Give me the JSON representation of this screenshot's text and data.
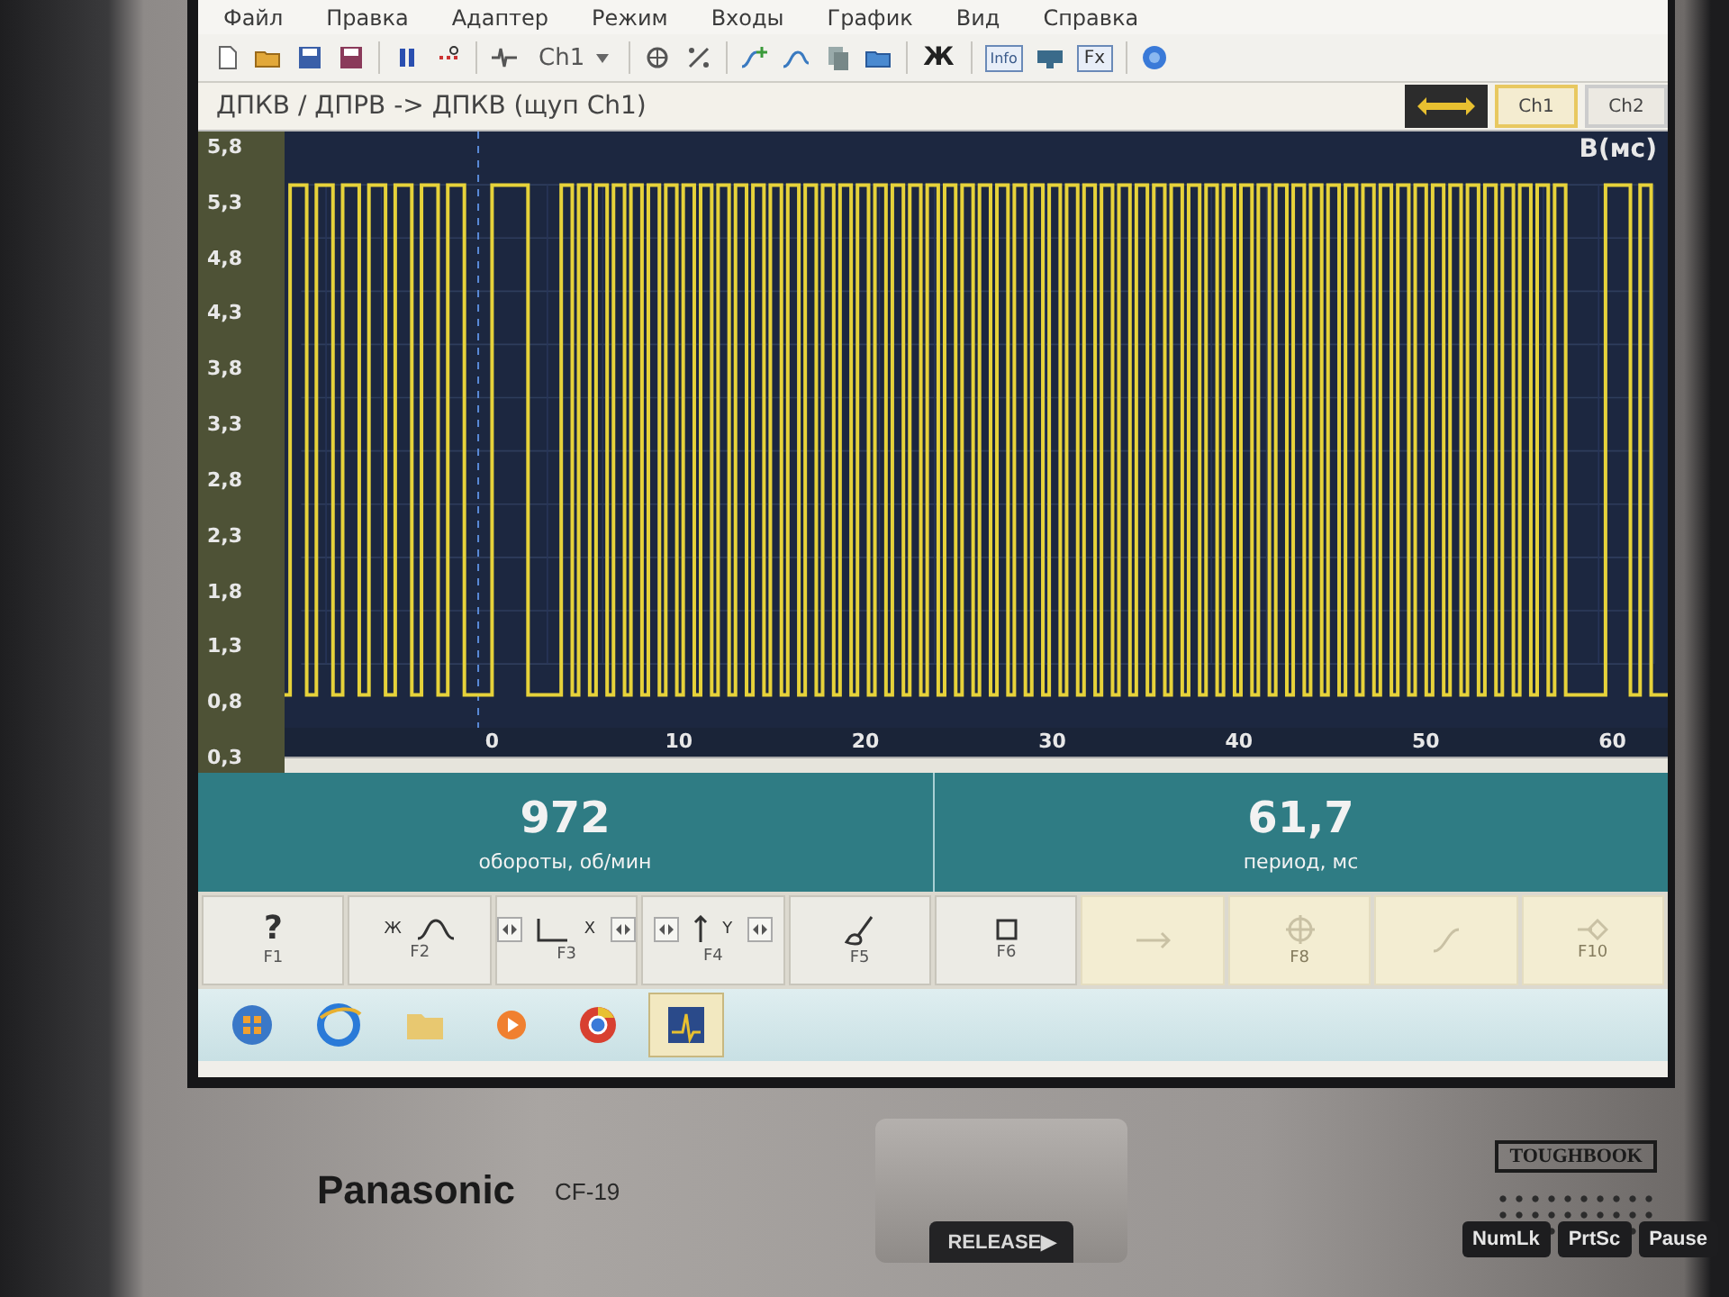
{
  "menu": [
    "Файл",
    "Правка",
    "Адаптер",
    "Режим",
    "Входы",
    "График",
    "Вид",
    "Справка"
  ],
  "toolbar": {
    "channel": "Ch1",
    "bold": "Ж",
    "info": "Info",
    "formula": "Fx"
  },
  "title": "ДПКВ / ДПРВ -> ДПКВ (щуп Ch1)",
  "channel_tabs": [
    {
      "label": "Ch1",
      "selected": true
    },
    {
      "label": "Ch2",
      "selected": false
    }
  ],
  "chart": {
    "unit": "В(мс)",
    "y_ticks": [
      "5,8",
      "5,3",
      "4,8",
      "4,3",
      "3,8",
      "3,3",
      "2,8",
      "2,3",
      "1,8",
      "1,3",
      "0,8",
      "0,3"
    ],
    "x_ticks": [
      "0",
      "10",
      "20",
      "30",
      "40",
      "50",
      "60"
    ]
  },
  "readouts": [
    {
      "value": "972",
      "label": "обороты, об/мин"
    },
    {
      "value": "61,7",
      "label": "период, мс"
    }
  ],
  "function_keys": [
    {
      "kind": "help",
      "glyph": "?",
      "key": "F1",
      "disabled": false
    },
    {
      "kind": "curve",
      "glyph": "Ж",
      "key": "F2",
      "disabled": false
    },
    {
      "kind": "x-axis",
      "glyph": "X",
      "key": "F3",
      "disabled": false
    },
    {
      "kind": "y-axis",
      "glyph": "Y",
      "key": "F4",
      "disabled": false
    },
    {
      "kind": "brush",
      "key": "F5",
      "disabled": false
    },
    {
      "kind": "square",
      "key": "F6",
      "disabled": false
    },
    {
      "kind": "arrow",
      "disabled": true
    },
    {
      "kind": "crosshair",
      "key": "F8",
      "disabled": true
    },
    {
      "kind": "slope",
      "disabled": true
    },
    {
      "kind": "exit",
      "key": "F10",
      "disabled": true
    }
  ],
  "taskbar": [
    {
      "kind": "start",
      "selected": false
    },
    {
      "kind": "browser",
      "selected": false
    },
    {
      "kind": "folder",
      "selected": false
    },
    {
      "kind": "media",
      "selected": false
    },
    {
      "kind": "ring",
      "selected": false
    },
    {
      "kind": "scope",
      "selected": true
    }
  ],
  "device": {
    "brand": "Panasonic",
    "model": "CF-19",
    "series": "TOUGHBOOK",
    "release": "RELEASE▶",
    "keys": [
      "NumLk",
      "PrtSc",
      "Pause"
    ]
  }
}
